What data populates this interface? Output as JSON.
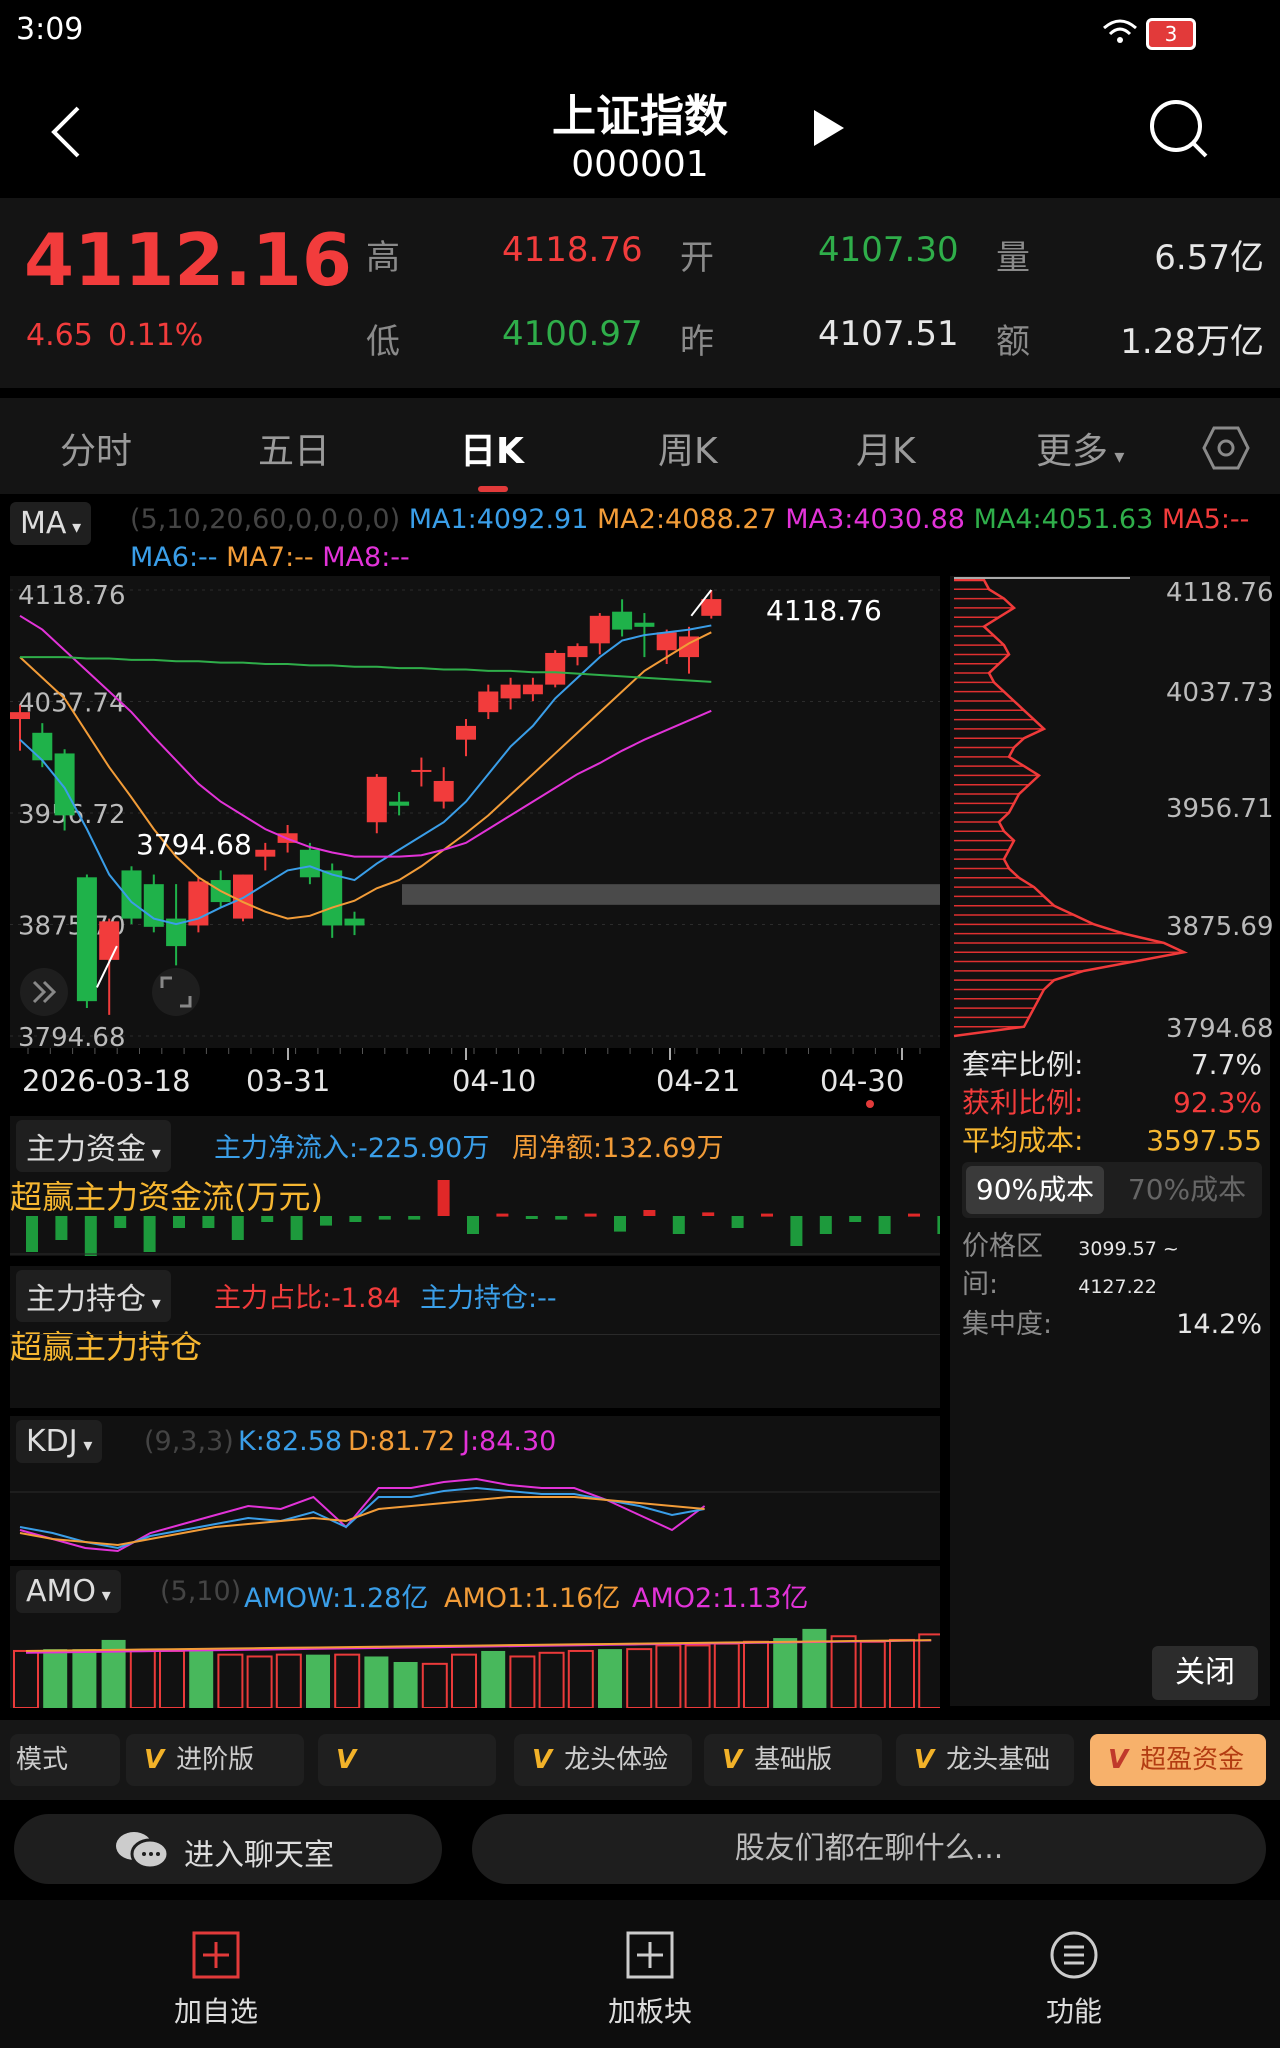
{
  "status": {
    "time": "3:09",
    "battery": "3"
  },
  "nav": {
    "title": "上证指数",
    "code": "000001"
  },
  "quote": {
    "price": "4112.16",
    "change": "4.65",
    "change_pct": "0.11%",
    "high_label": "高",
    "high": "4118.76",
    "low_label": "低",
    "low": "4100.97",
    "open_label": "开",
    "open": "4107.30",
    "prev_label": "昨",
    "prev": "4107.51",
    "vol_label": "量",
    "vol": "6.57亿",
    "amt_label": "额",
    "amt": "1.28万亿"
  },
  "tabs": [
    "分时",
    "五日",
    "日K",
    "周K",
    "月K",
    "更多"
  ],
  "active_tab": "日K",
  "ma": {
    "selector": "MA",
    "params": "(5,10,20,60,0,0,0,0)",
    "ma1": "MA1:4092.91",
    "ma2": "MA2:4088.27",
    "ma3": "MA3:4030.88",
    "ma4": "MA4:4051.63",
    "ma5": "MA5:--",
    "ma6": "MA6:--",
    "ma7": "MA7:--",
    "ma8": "MA8:--"
  },
  "chart_data": {
    "type": "candlestick",
    "ylim": [
      3794.68,
      4118.76
    ],
    "y_ticks": [
      "4118.76",
      "4037.74",
      "3956.72",
      "3875.70",
      "3794.68"
    ],
    "x_ticks": [
      "2026-03-18",
      "03-31",
      "04-10",
      "04-21",
      "04-30"
    ],
    "high_label": "4118.76",
    "low_label": "3794.68",
    "candles": [
      {
        "o": 4025,
        "h": 4035,
        "l": 4002,
        "c": 4030
      },
      {
        "o": 4015,
        "h": 4022,
        "l": 3990,
        "c": 3995
      },
      {
        "o": 4000,
        "h": 4003,
        "l": 3944,
        "c": 3955
      },
      {
        "o": 3910,
        "h": 3912,
        "l": 3815,
        "c": 3820
      },
      {
        "o": 3850,
        "h": 3880,
        "l": 3810,
        "c": 3878
      },
      {
        "o": 3915,
        "h": 3918,
        "l": 3876,
        "c": 3880
      },
      {
        "o": 3905,
        "h": 3912,
        "l": 3870,
        "c": 3874
      },
      {
        "o": 3880,
        "h": 3905,
        "l": 3846,
        "c": 3860
      },
      {
        "o": 3875,
        "h": 3910,
        "l": 3870,
        "c": 3907
      },
      {
        "o": 3908,
        "h": 3915,
        "l": 3888,
        "c": 3892
      },
      {
        "o": 3880,
        "h": 3912,
        "l": 3878,
        "c": 3912
      },
      {
        "o": 3925,
        "h": 3935,
        "l": 3915,
        "c": 3930
      },
      {
        "o": 3935,
        "h": 3948,
        "l": 3928,
        "c": 3942
      },
      {
        "o": 3930,
        "h": 3935,
        "l": 3905,
        "c": 3910
      },
      {
        "o": 3915,
        "h": 3920,
        "l": 3866,
        "c": 3875
      },
      {
        "o": 3880,
        "h": 3885,
        "l": 3868,
        "c": 3875
      },
      {
        "o": 3950,
        "h": 3985,
        "l": 3942,
        "c": 3983
      },
      {
        "o": 3965,
        "h": 3972,
        "l": 3955,
        "c": 3962
      },
      {
        "o": 3987,
        "h": 3997,
        "l": 3976,
        "c": 3988
      },
      {
        "o": 3965,
        "h": 3990,
        "l": 3960,
        "c": 3980
      },
      {
        "o": 4010,
        "h": 4025,
        "l": 3998,
        "c": 4020
      },
      {
        "o": 4030,
        "h": 4050,
        "l": 4025,
        "c": 4045
      },
      {
        "o": 4040,
        "h": 4055,
        "l": 4032,
        "c": 4050
      },
      {
        "o": 4043,
        "h": 4055,
        "l": 4038,
        "c": 4050
      },
      {
        "o": 4050,
        "h": 4075,
        "l": 4048,
        "c": 4073
      },
      {
        "o": 4070,
        "h": 4080,
        "l": 4064,
        "c": 4078
      },
      {
        "o": 4080,
        "h": 4102,
        "l": 4072,
        "c": 4100
      },
      {
        "o": 4103,
        "h": 4112,
        "l": 4085,
        "c": 4090
      },
      {
        "o": 4095,
        "h": 4102,
        "l": 4070,
        "c": 4092
      },
      {
        "o": 4075,
        "h": 4090,
        "l": 4065,
        "c": 4088
      },
      {
        "o": 4070,
        "h": 4092,
        "l": 4058,
        "c": 4085
      },
      {
        "o": 4100,
        "h": 4118.76,
        "l": 4098,
        "c": 4112.16
      }
    ],
    "ma1": [
      4010,
      3995,
      3975,
      3945,
      3912,
      3892,
      3880,
      3876,
      3880,
      3888,
      3895,
      3905,
      3915,
      3918,
      3912,
      3908,
      3920,
      3930,
      3940,
      3950,
      3965,
      3985,
      4005,
      4020,
      4040,
      4055,
      4070,
      4082,
      4086,
      4088,
      4090,
      4093
    ],
    "ma2": [
      4070,
      4055,
      4040,
      4015,
      3990,
      3968,
      3945,
      3925,
      3910,
      3900,
      3892,
      3885,
      3880,
      3882,
      3888,
      3893,
      3902,
      3908,
      3918,
      3930,
      3942,
      3955,
      3970,
      3985,
      4000,
      4015,
      4030,
      4045,
      4060,
      4070,
      4080,
      4088
    ],
    "ma3": [
      4100,
      4090,
      4075,
      4060,
      4045,
      4030,
      4012,
      3995,
      3978,
      3965,
      3955,
      3945,
      3938,
      3932,
      3928,
      3925,
      3925,
      3925,
      3926,
      3930,
      3935,
      3945,
      3955,
      3965,
      3975,
      3985,
      3993,
      4002,
      4010,
      4017,
      4024,
      4031
    ],
    "ma4": [
      4070,
      4070,
      4070,
      4069,
      4069,
      4068,
      4068,
      4067,
      4067,
      4066,
      4066,
      4065,
      4065,
      4064,
      4064,
      4063,
      4063,
      4062,
      4062,
      4061,
      4061,
      4060,
      4060,
      4059,
      4059,
      4058,
      4057,
      4056,
      4055,
      4054,
      4053,
      4052
    ]
  },
  "chip": {
    "trap_label": "套牢比例:",
    "trap": "7.7%",
    "profit_label": "获利比例:",
    "profit": "92.3%",
    "avg_label": "平均成本:",
    "avg": "3597.55",
    "btn90": "90%成本",
    "btn70": "70%成本",
    "range_label": "价格区间:",
    "range": "3099.57 ~ 4127.22",
    "conc_label": "集中度:",
    "conc": "14.2%",
    "close": "关闭",
    "prices": [
      "4118.76",
      "4037.73",
      "3956.71",
      "3875.69",
      "3794.68"
    ]
  },
  "fund": {
    "selector": "主力资金",
    "net_in": "主力净流入:-225.90万",
    "week_net": "周净额:132.69万",
    "title": "超赢主力资金流(万元)"
  },
  "hold": {
    "selector": "主力持仓",
    "ratio": "主力占比:-1.84",
    "pos": "主力持仓:--",
    "title": "超赢主力持仓"
  },
  "kdj": {
    "selector": "KDJ",
    "params": "(9,3,3)",
    "k": "K:82.58",
    "d": "D:81.72",
    "j": "J:84.30"
  },
  "amo": {
    "selector": "AMO",
    "params": "(5,10)",
    "amow": "AMOW:1.28亿",
    "amo1": "AMO1:1.16亿",
    "amo2": "AMO2:1.13亿"
  },
  "modes": [
    "模式",
    "进阶版",
    "",
    "龙头体验",
    "基础版",
    "龙头基础",
    "超盈资金"
  ],
  "chat": {
    "enter": "进入聊天室",
    "prompt": "股友们都在聊什么..."
  },
  "bottom": {
    "add_fav": "加自选",
    "add_block": "加板块",
    "func": "功能"
  }
}
